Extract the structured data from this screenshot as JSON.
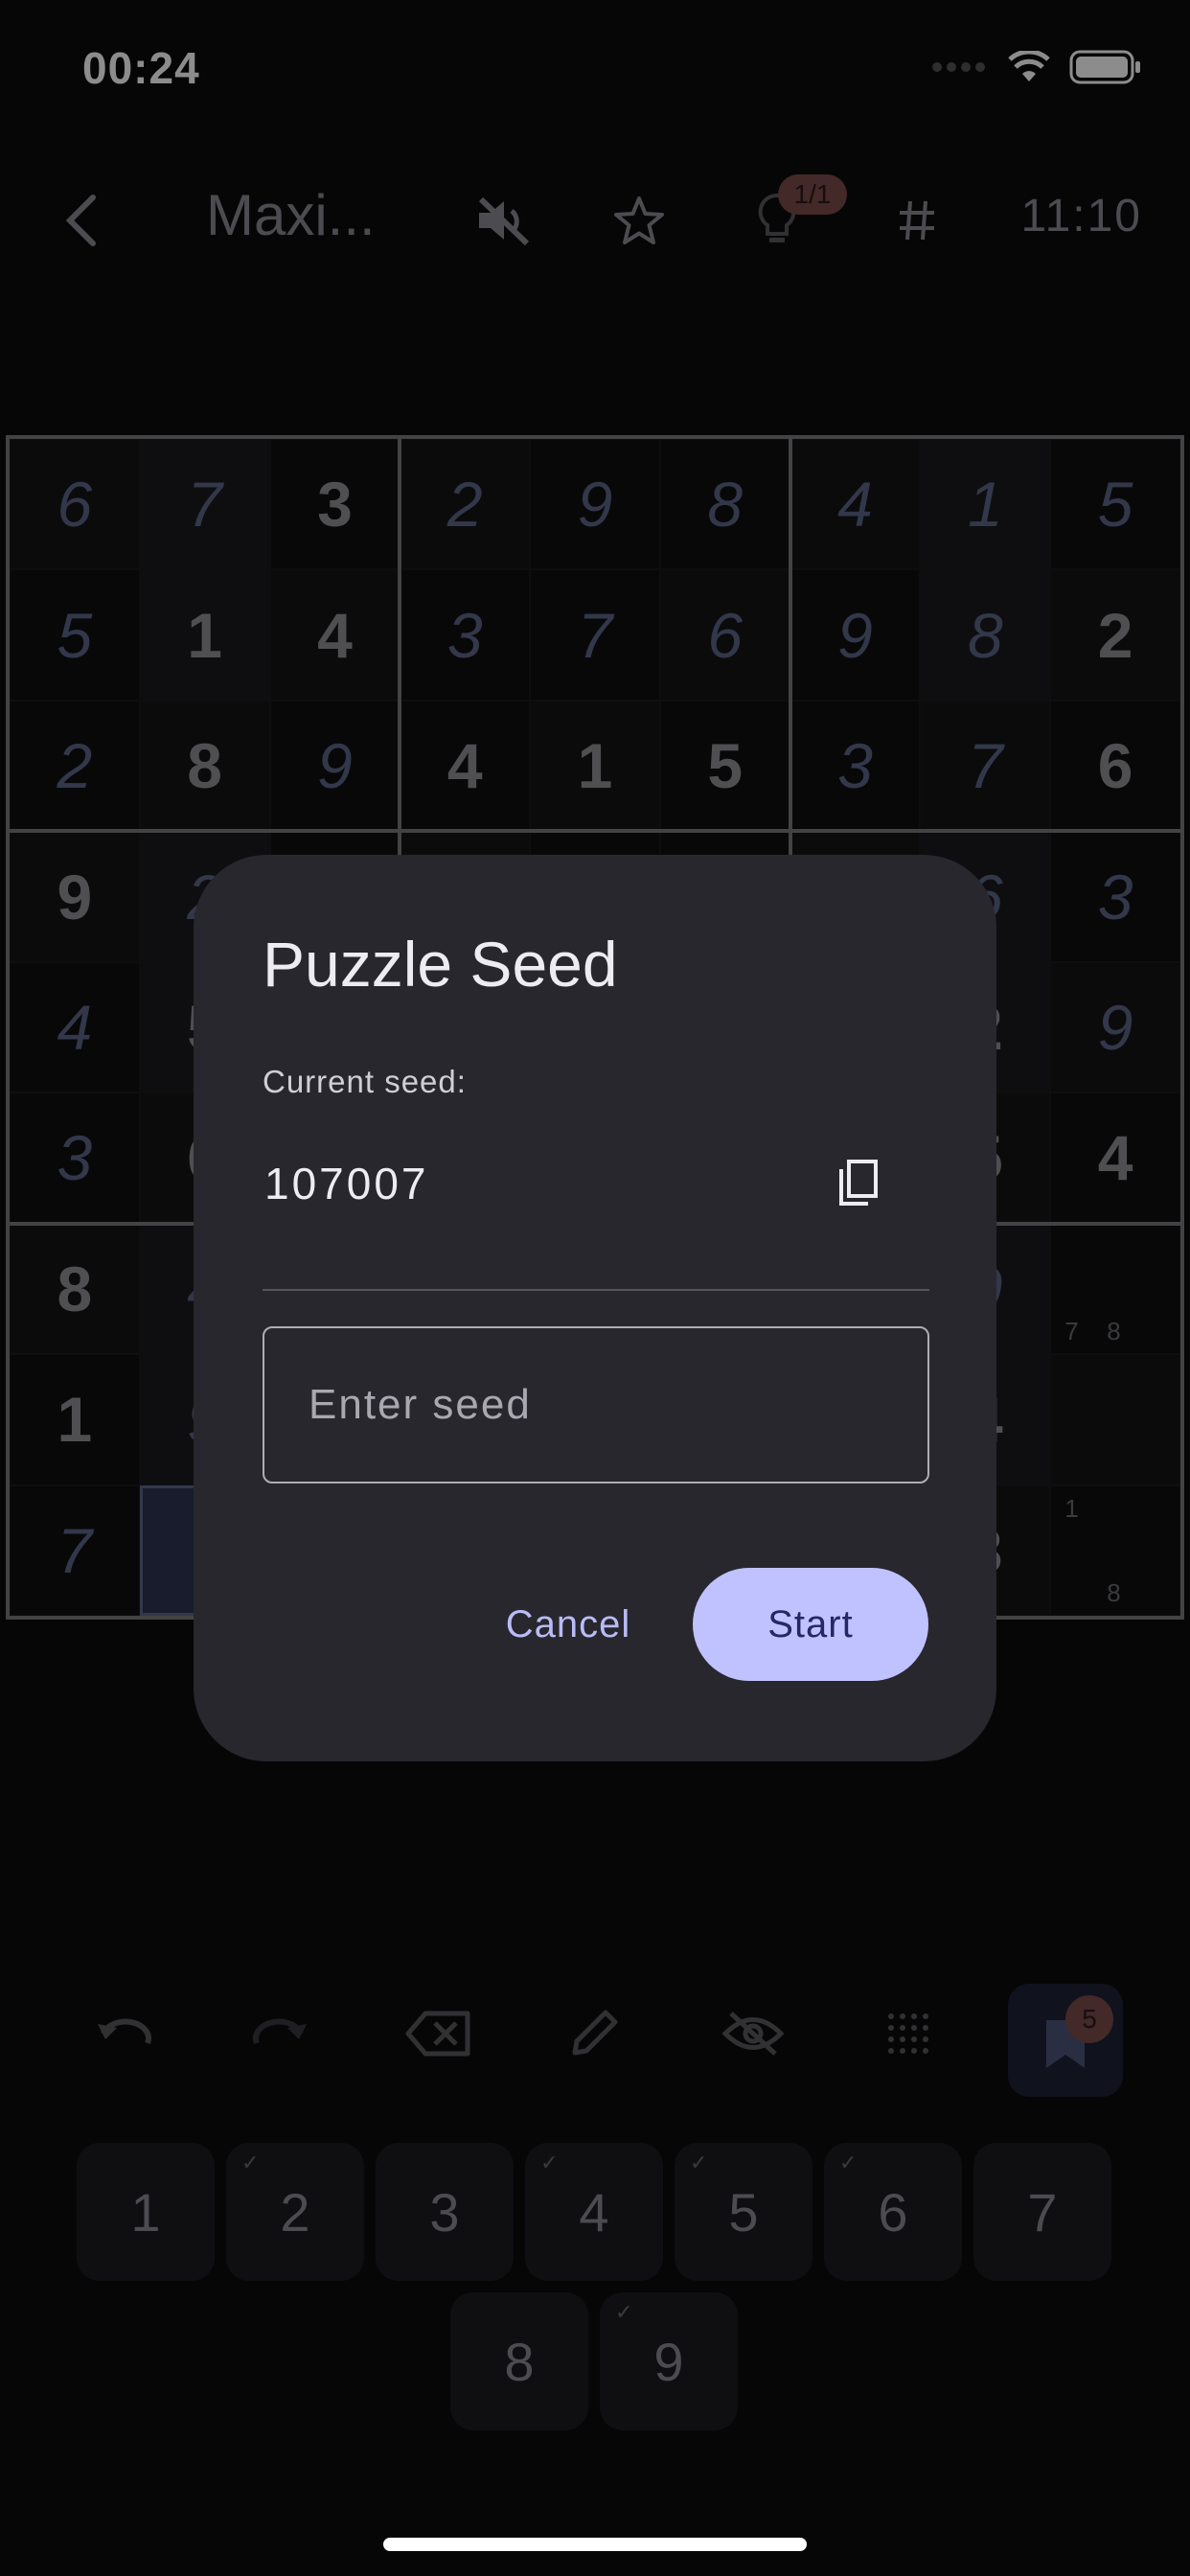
{
  "status": {
    "time": "00:24"
  },
  "header": {
    "title": "Maxi...",
    "timer": "11:10",
    "hint_count": "1/1"
  },
  "board": {
    "rows": [
      [
        {
          "v": "6",
          "t": "e"
        },
        {
          "v": "7",
          "t": "e"
        },
        {
          "v": "3",
          "t": "g"
        },
        {
          "v": "2",
          "t": "e"
        },
        {
          "v": "9",
          "t": "e"
        },
        {
          "v": "8",
          "t": "e"
        },
        {
          "v": "4",
          "t": "e"
        },
        {
          "v": "1",
          "t": "e"
        },
        {
          "v": "5",
          "t": "e"
        }
      ],
      [
        {
          "v": "5",
          "t": "e"
        },
        {
          "v": "1",
          "t": "g"
        },
        {
          "v": "4",
          "t": "g"
        },
        {
          "v": "3",
          "t": "e"
        },
        {
          "v": "7",
          "t": "e"
        },
        {
          "v": "6",
          "t": "e"
        },
        {
          "v": "9",
          "t": "e"
        },
        {
          "v": "8",
          "t": "e"
        },
        {
          "v": "2",
          "t": "g"
        }
      ],
      [
        {
          "v": "2",
          "t": "e"
        },
        {
          "v": "8",
          "t": "g"
        },
        {
          "v": "9",
          "t": "e"
        },
        {
          "v": "4",
          "t": "g"
        },
        {
          "v": "1",
          "t": "g"
        },
        {
          "v": "5",
          "t": "g"
        },
        {
          "v": "3",
          "t": "e"
        },
        {
          "v": "7",
          "t": "e"
        },
        {
          "v": "6",
          "t": "g"
        }
      ],
      [
        {
          "v": "9",
          "t": "g"
        },
        {
          "v": "2",
          "t": "e"
        },
        {
          "v": "",
          "t": "x"
        },
        {
          "v": "",
          "t": "x"
        },
        {
          "v": "",
          "t": "x"
        },
        {
          "v": "",
          "t": "x"
        },
        {
          "v": "",
          "t": "x"
        },
        {
          "v": "6",
          "t": "e"
        },
        {
          "v": "3",
          "t": "e"
        }
      ],
      [
        {
          "v": "4",
          "t": "e"
        },
        {
          "v": "5",
          "t": "g"
        },
        {
          "v": "",
          "t": "x"
        },
        {
          "v": "",
          "t": "x"
        },
        {
          "v": "",
          "t": "x"
        },
        {
          "v": "",
          "t": "x"
        },
        {
          "v": "",
          "t": "x"
        },
        {
          "v": "2",
          "t": "g"
        },
        {
          "v": "9",
          "t": "e"
        }
      ],
      [
        {
          "v": "3",
          "t": "e"
        },
        {
          "v": "6",
          "t": "g"
        },
        {
          "v": "",
          "t": "x"
        },
        {
          "v": "",
          "t": "x"
        },
        {
          "v": "",
          "t": "x"
        },
        {
          "v": "",
          "t": "x"
        },
        {
          "v": "",
          "t": "x"
        },
        {
          "v": "5",
          "t": "g"
        },
        {
          "v": "4",
          "t": "g"
        }
      ],
      [
        {
          "v": "8",
          "t": "g"
        },
        {
          "v": "4",
          "t": "e"
        },
        {
          "v": "",
          "t": "x"
        },
        {
          "v": "",
          "t": "x"
        },
        {
          "v": "",
          "t": "x"
        },
        {
          "v": "",
          "t": "x"
        },
        {
          "v": "",
          "t": "x"
        },
        {
          "v": "9",
          "t": "e"
        },
        {
          "v": "",
          "t": "n",
          "notes": [
            "7",
            "8"
          ]
        }
      ],
      [
        {
          "v": "1",
          "t": "g"
        },
        {
          "v": "9",
          "t": "e"
        },
        {
          "v": "",
          "t": "x"
        },
        {
          "v": "",
          "t": "x"
        },
        {
          "v": "",
          "t": "x"
        },
        {
          "v": "",
          "t": "x"
        },
        {
          "v": "",
          "t": "x"
        },
        {
          "v": "4",
          "t": "g"
        },
        {
          "v": "",
          "t": "x"
        }
      ],
      [
        {
          "v": "7",
          "t": "e"
        },
        {
          "v": "",
          "t": "sel"
        },
        {
          "v": "",
          "t": "x"
        },
        {
          "v": "",
          "t": "x"
        },
        {
          "v": "",
          "t": "x"
        },
        {
          "v": "",
          "t": "x"
        },
        {
          "v": "",
          "t": "x"
        },
        {
          "v": "3",
          "t": "g"
        },
        {
          "v": "",
          "t": "n",
          "notes": [
            "1",
            "8"
          ]
        }
      ]
    ]
  },
  "dialog": {
    "title": "Puzzle Seed",
    "current_label": "Current seed:",
    "seed_value": "107007",
    "input_placeholder": "Enter seed",
    "cancel_label": "Cancel",
    "start_label": "Start"
  },
  "toolbar": {
    "notes_count": "5"
  },
  "keypad": {
    "keys": [
      {
        "label": "1",
        "done": false
      },
      {
        "label": "2",
        "done": true
      },
      {
        "label": "3",
        "done": false
      },
      {
        "label": "4",
        "done": true
      },
      {
        "label": "5",
        "done": true
      },
      {
        "label": "6",
        "done": true
      },
      {
        "label": "7",
        "done": false
      },
      {
        "label": "8",
        "done": false
      },
      {
        "label": "9",
        "done": true
      }
    ]
  },
  "colors": {
    "accent": "#bfc2ff",
    "dialog_bg": "#28272e",
    "badge": "#7a4b48",
    "entered_digit": "#5c6488"
  }
}
